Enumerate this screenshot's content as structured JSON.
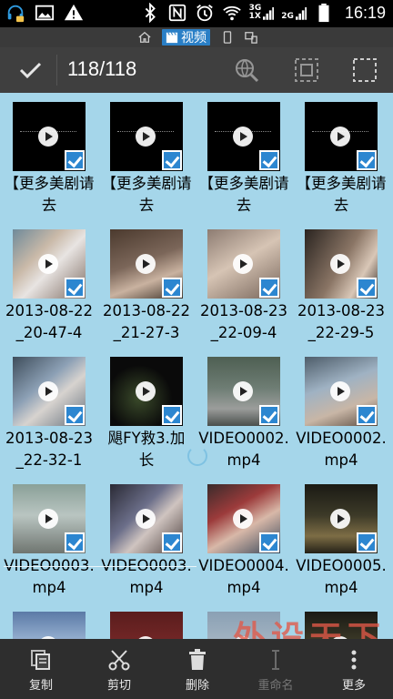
{
  "status_bar": {
    "time": "16:19",
    "icons": [
      "headset-notify-icon",
      "image-icon",
      "warning-icon",
      "bluetooth-icon",
      "nfc-icon",
      "alarm-icon",
      "wifi-icon",
      "signal-3g-icon",
      "signal-2g-icon",
      "battery-icon"
    ],
    "network_3g_label": "3G",
    "network_1x_label": "1X",
    "network_2g_label": "2G"
  },
  "mode_bar": {
    "items": [
      {
        "icon": "home-icon",
        "label": ""
      },
      {
        "icon": "video-clapper-icon",
        "label": "视频",
        "active": true
      },
      {
        "icon": "phone-icon",
        "label": ""
      },
      {
        "icon": "devices-icon",
        "label": ""
      }
    ]
  },
  "action_bar": {
    "count": "118/118",
    "actions": [
      "globe-search-icon",
      "select-grid-icon",
      "select-all-icon"
    ]
  },
  "grid": {
    "items": [
      {
        "caption": "【更多美剧请去",
        "thumb": "t-dark"
      },
      {
        "caption": "【更多美剧请去",
        "thumb": "t-dark"
      },
      {
        "caption": "【更多美剧请去",
        "thumb": "t-dark"
      },
      {
        "caption": "【更多美剧请去",
        "thumb": "t-dark"
      },
      {
        "caption": "2013-08-22_20-47-4",
        "thumb": "t-baby"
      },
      {
        "caption": "2013-08-22_21-27-3",
        "thumb": "t-bed"
      },
      {
        "caption": "2013-08-23_22-09-4",
        "thumb": "t-room"
      },
      {
        "caption": "2013-08-23_22-29-5",
        "thumb": "t-bed2"
      },
      {
        "caption": "2013-08-23_22-32-1",
        "thumb": "t-baby2"
      },
      {
        "caption": "飓FY救3.加长",
        "thumb": "t-night"
      },
      {
        "caption": "VIDEO0002.mp4",
        "thumb": "t-street"
      },
      {
        "caption": "VIDEO0002.mp4",
        "thumb": "t-bed3"
      },
      {
        "caption": "VIDEO0003.mp4",
        "thumb": "t-road"
      },
      {
        "caption": "VIDEO0003.mp4",
        "thumb": "t-cloth"
      },
      {
        "caption": "VIDEO0004.mp4",
        "thumb": "t-toys"
      },
      {
        "caption": "VIDEO0005.mp4",
        "thumb": "t-night2"
      },
      {
        "caption": "",
        "thumb": "t-sky"
      },
      {
        "caption": "",
        "thumb": "t-red"
      },
      {
        "caption": "",
        "thumb": "t-plain"
      },
      {
        "caption": "",
        "thumb": "t-night2"
      }
    ]
  },
  "watermark": {
    "text": "外设天下",
    "url": "pcwaishe.cn"
  },
  "bottom_bar": {
    "copy_label": "复制",
    "cut_label": "剪切",
    "delete_label": "删除",
    "rename_label": "重命名",
    "more_label": "更多"
  }
}
